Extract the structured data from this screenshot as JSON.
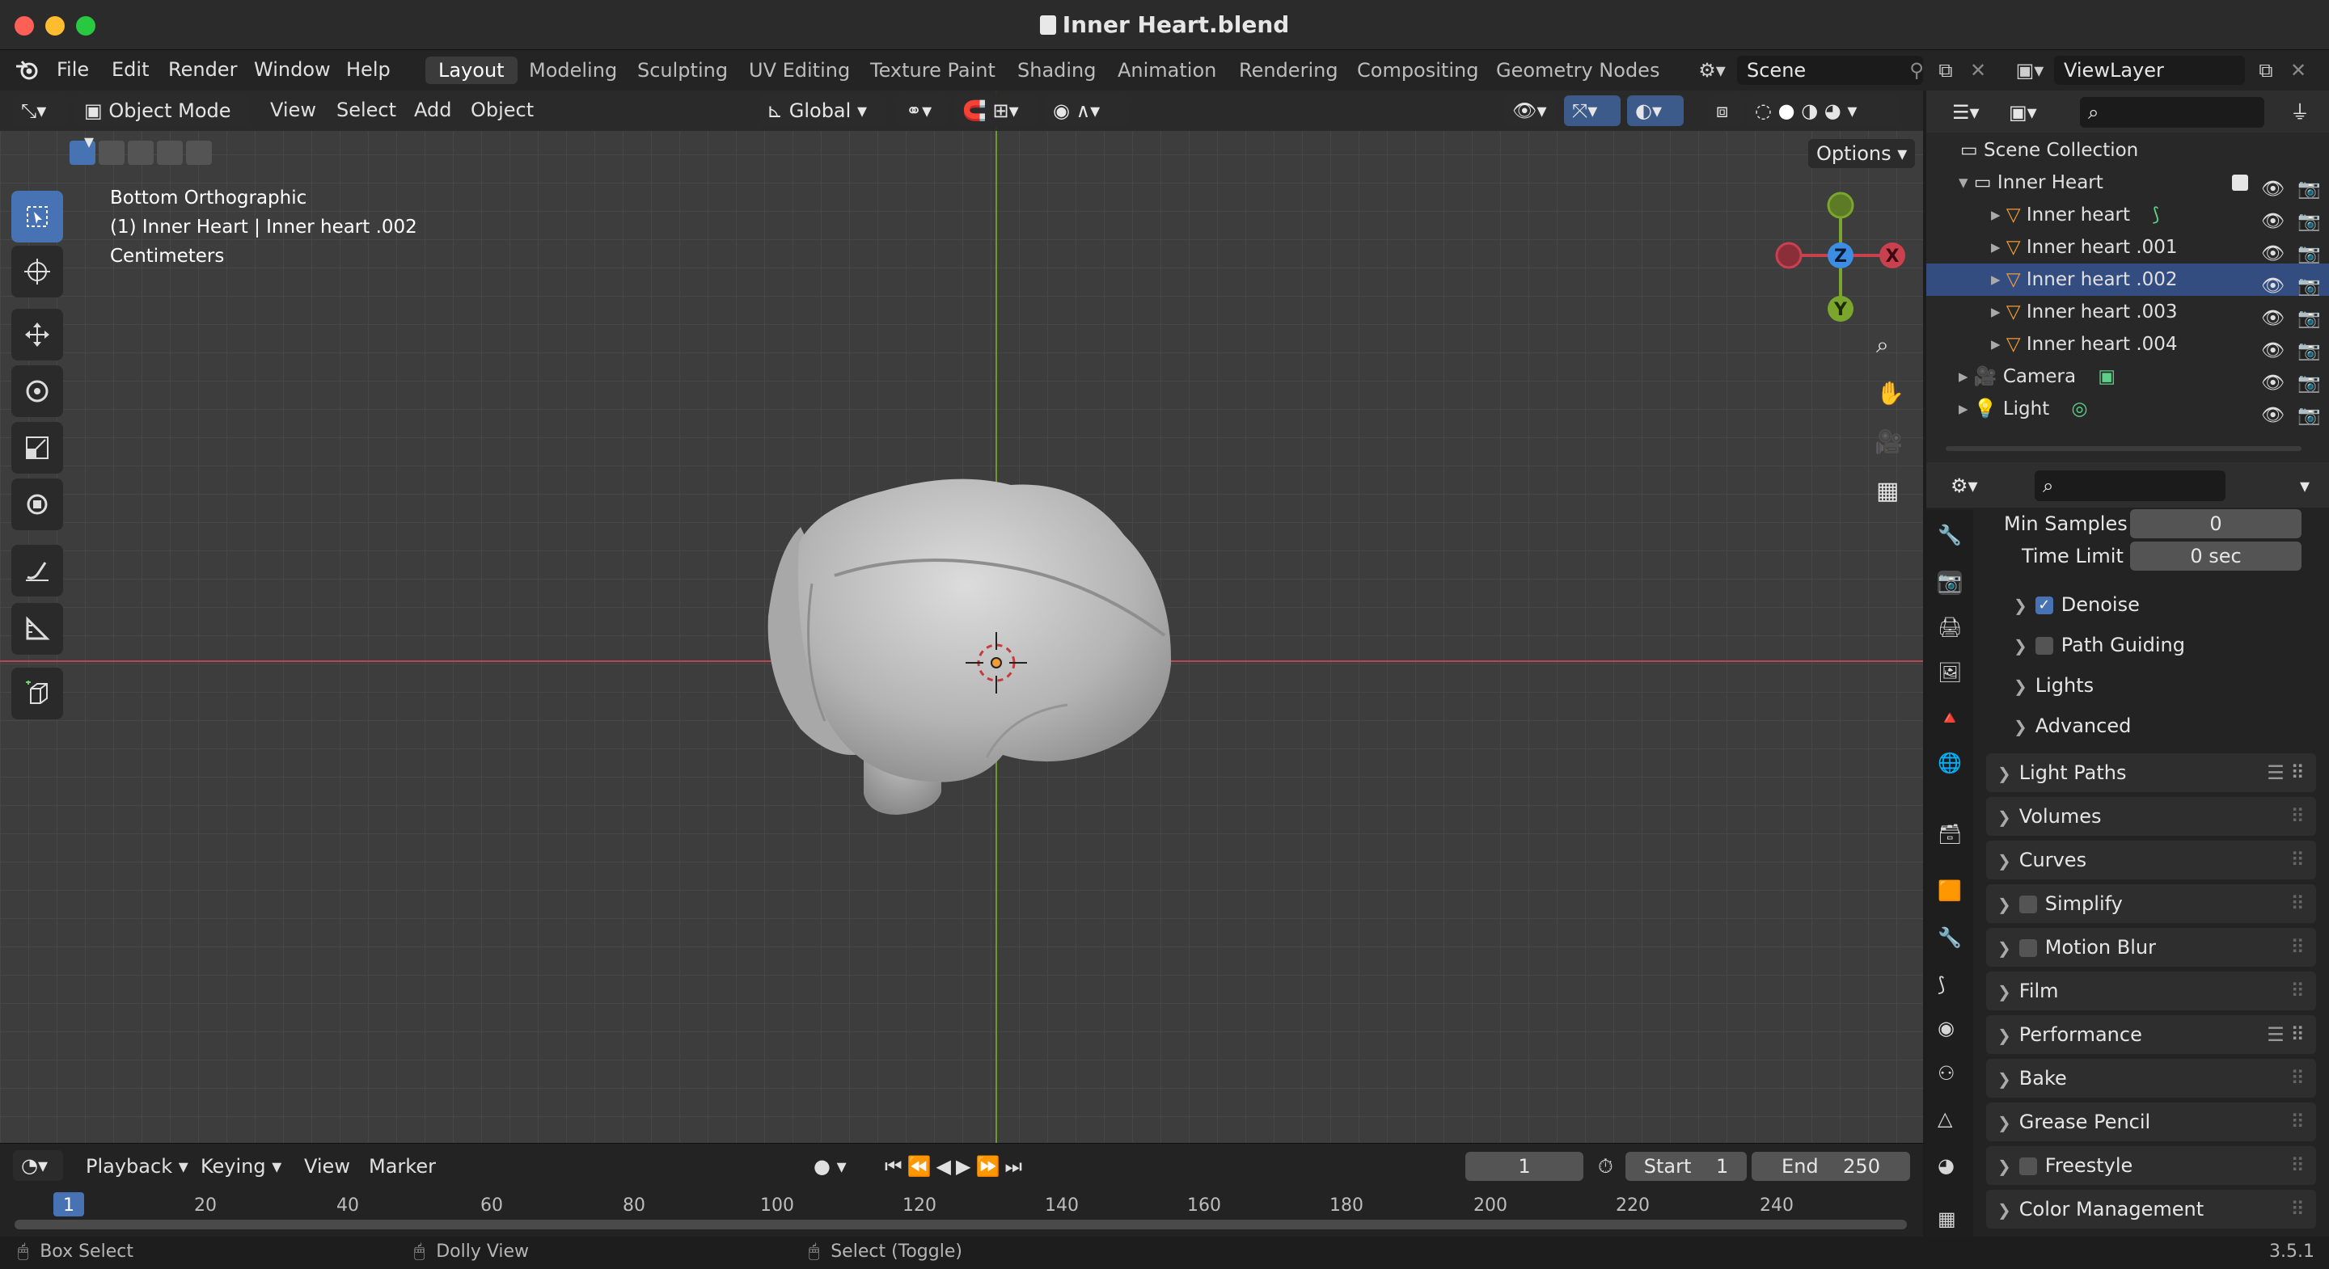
{
  "window": {
    "title": "Inner Heart.blend"
  },
  "menu": {
    "file": "File",
    "edit": "Edit",
    "render": "Render",
    "window": "Window",
    "help": "Help"
  },
  "workspaces": [
    "Layout",
    "Modeling",
    "Sculpting",
    "UV Editing",
    "Texture Paint",
    "Shading",
    "Animation",
    "Rendering",
    "Compositing",
    "Geometry Nodes"
  ],
  "scene": {
    "name": "Scene",
    "view_layer": "ViewLayer"
  },
  "viewport_header": {
    "mode": "Object Mode",
    "view": "View",
    "select": "Select",
    "add": "Add",
    "object": "Object",
    "orientation": "Global",
    "options": "Options"
  },
  "viewport_info": {
    "view_name": "Bottom Orthographic",
    "selection": "(1) Inner Heart | Inner heart .002",
    "units": "Centimeters"
  },
  "gizmo": {
    "x": "X",
    "y": "Y",
    "z": "Z"
  },
  "outliner": {
    "root": "Scene Collection",
    "collection": "Inner Heart",
    "items": [
      {
        "label": "Inner heart",
        "selected": false
      },
      {
        "label": "Inner heart .001",
        "selected": false
      },
      {
        "label": "Inner heart .002",
        "selected": true
      },
      {
        "label": "Inner heart .003",
        "selected": false
      },
      {
        "label": "Inner heart .004",
        "selected": false
      }
    ],
    "camera": "Camera",
    "light": "Light"
  },
  "properties": {
    "min_samples_label": "Min Samples",
    "min_samples_value": "0",
    "time_limit_label": "Time Limit",
    "time_limit_value": "0 sec",
    "subpanels": {
      "denoise": "Denoise",
      "path_guiding": "Path Guiding",
      "lights": "Lights",
      "advanced": "Advanced"
    },
    "panels": [
      "Light Paths",
      "Volumes",
      "Curves",
      "Simplify",
      "Motion Blur",
      "Film",
      "Performance",
      "Bake",
      "Grease Pencil",
      "Freestyle",
      "Color Management"
    ]
  },
  "timeline": {
    "playback": "Playback",
    "keying": "Keying",
    "view": "View",
    "marker": "Marker",
    "current_frame": "1",
    "start_label": "Start",
    "start_value": "1",
    "end_label": "End",
    "end_value": "250",
    "ticks": [
      "1",
      "20",
      "40",
      "60",
      "80",
      "100",
      "120",
      "140",
      "160",
      "180",
      "200",
      "220",
      "240"
    ]
  },
  "statusbar": {
    "box_select": "Box Select",
    "dolly_view": "Dolly View",
    "select_toggle": "Select (Toggle)",
    "version": "3.5.1"
  },
  "colors": {
    "accent": "#4772b3",
    "selected_row": "#334d80",
    "x_axis": "#c9414f",
    "y_axis": "#7aa62d",
    "z_axis": "#3d8ee3",
    "object_origin": "#f29c33"
  }
}
